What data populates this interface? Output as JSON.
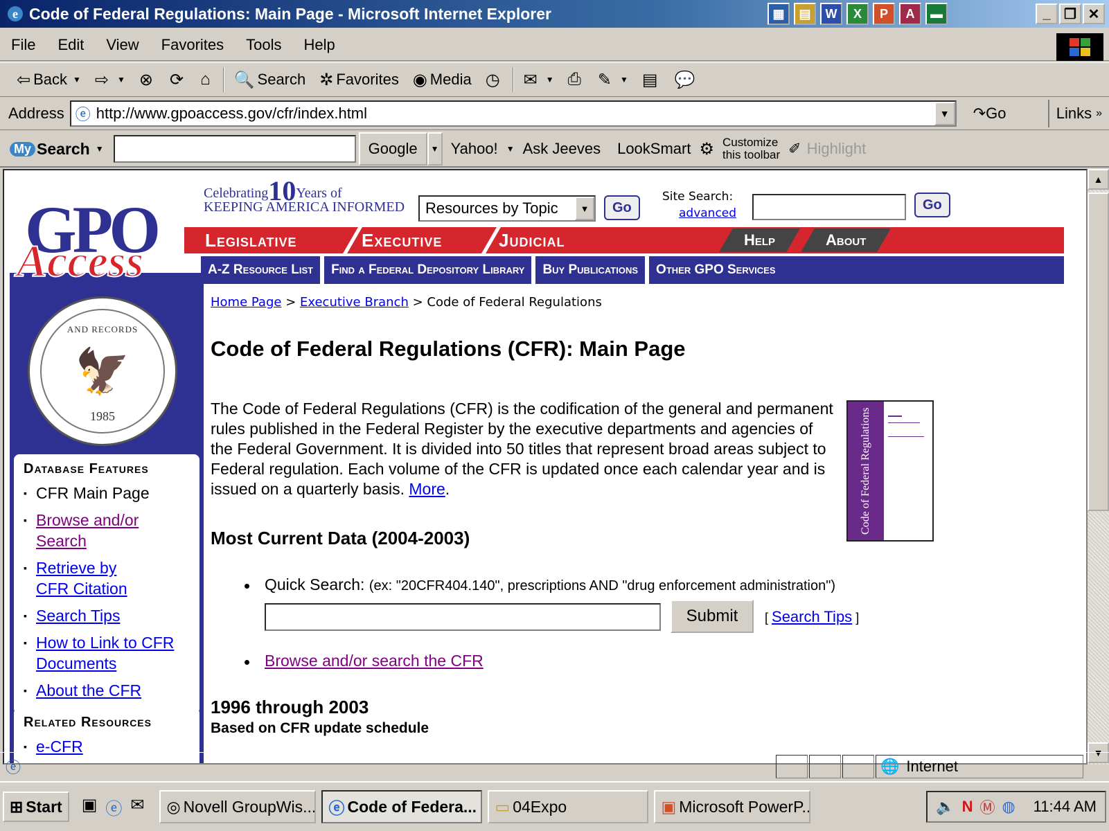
{
  "window": {
    "title": "Code of Federal Regulations: Main Page - Microsoft Internet Explorer",
    "min": "_",
    "max": "❐",
    "close": "✕"
  },
  "menu": [
    "File",
    "Edit",
    "View",
    "Favorites",
    "Tools",
    "Help"
  ],
  "toolbar": {
    "back": "Back",
    "search": "Search",
    "favorites": "Favorites",
    "media": "Media"
  },
  "address": {
    "label": "Address",
    "url": "http://www.gpoaccess.gov/cfr/index.html",
    "go": "Go",
    "links": "Links"
  },
  "mysearch": {
    "logo_my": "My",
    "logo_search": "Search",
    "google": "Google",
    "yahoo": "Yahoo!",
    "ask": "Ask Jeeves",
    "looksmart": "LookSmart",
    "customize_1": "Customize",
    "customize_2": "this toolbar",
    "highlight": "Highlight"
  },
  "page": {
    "logo_gpo": "GPO",
    "logo_access": "Access",
    "celebrating_1": "Celebrating",
    "celebrating_10": "10",
    "celebrating_years": "Years of",
    "celebrating_2": "KEEPING AMERICA INFORMED",
    "topic_select": "Resources by Topic",
    "go": "Go",
    "site_search": "Site Search:",
    "advanced": "advanced",
    "nav_red": [
      "Legislative",
      "Executive",
      "Judicial"
    ],
    "nav_gray": [
      "Help",
      "About"
    ],
    "nav_blue": [
      "A-Z Resource List",
      "Find a Federal Depository Library",
      "Buy Publications",
      "Other GPO Services"
    ],
    "seal_text": "AND RECORDS",
    "seal_year": "1985",
    "db_features_title": "Database Features",
    "db_features": {
      "main": "CFR Main Page",
      "browse": "Browse and/or Search",
      "retrieve_1": "Retrieve by",
      "retrieve_2": "CFR Citation",
      "tips": "Search Tips",
      "link_1": "How to Link to CFR",
      "link_2": "Documents",
      "about": "About the CFR"
    },
    "related_title": "Related Resources",
    "related_first": "e-CFR",
    "breadcrumb": {
      "home": "Home Page",
      "sep": " > ",
      "exec": "Executive Branch",
      "current": "Code of Federal Regulations"
    },
    "heading": "Code of Federal Regulations (CFR): Main Page",
    "intro": "The Code of Federal Regulations (CFR) is the codification of the general and permanent rules published in the Federal Register by the executive departments and agencies of the Federal Government. It is divided into 50 titles that represent broad areas subject to Federal regulation. Each volume of the CFR is updated once each calendar year and is issued on a quarterly basis.",
    "more": "More",
    "cover_title": "Code of Federal Regulations",
    "current_heading": "Most Current Data (2004-2003)",
    "quick_search": "Quick Search:",
    "quick_example": "(ex: \"20CFR404.140\", prescriptions AND \"drug enforcement administration\")",
    "submit": "Submit",
    "search_tips": "Search Tips",
    "browse_cfr": "Browse and/or search the CFR",
    "range_heading": "1996 through 2003",
    "range_sub": "Based on CFR update schedule"
  },
  "status": {
    "zone": "Internet"
  },
  "taskbar": {
    "start": "Start",
    "tasks": [
      "Novell GroupWis...",
      "Code of Federa...",
      "04Expo",
      "Microsoft PowerP..."
    ],
    "time": "11:44 AM"
  }
}
